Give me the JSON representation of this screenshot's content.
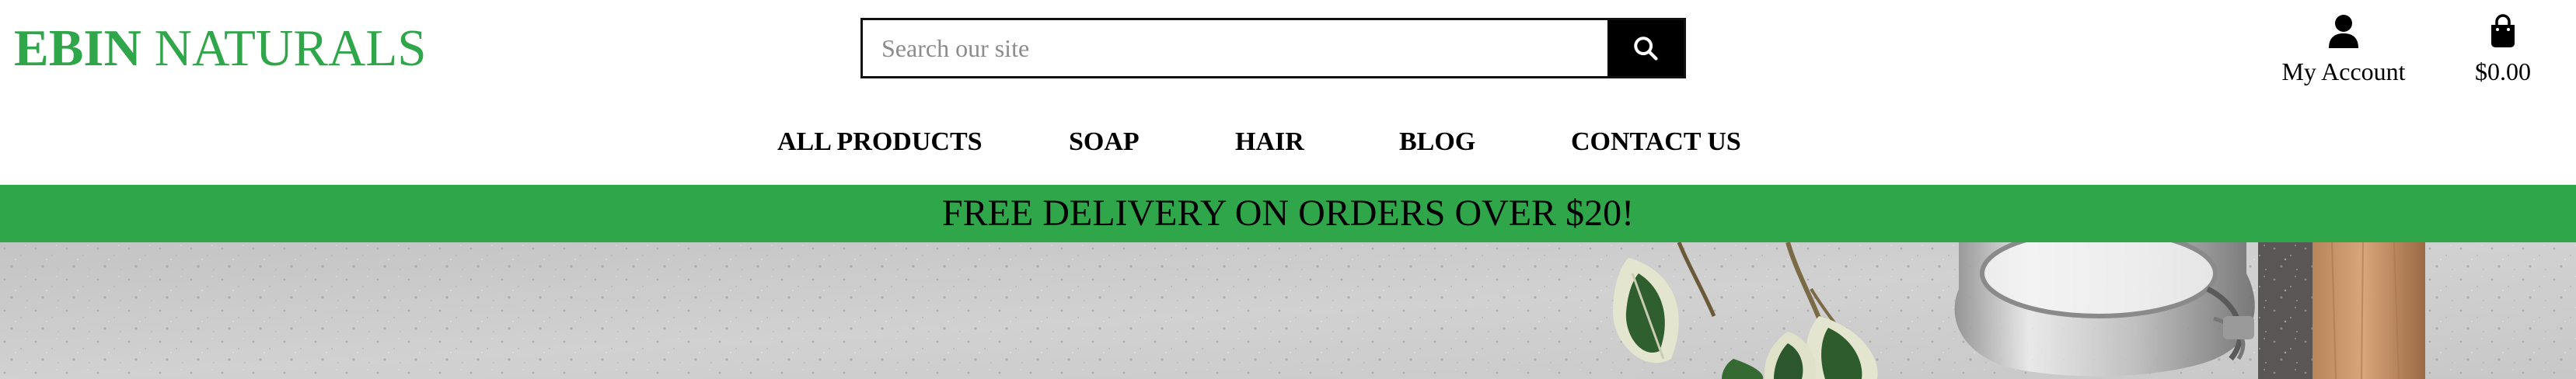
{
  "logo": {
    "bold_part": "EBIN",
    "rest_part": " NATURALS"
  },
  "search": {
    "placeholder": "Search our site",
    "value": ""
  },
  "account": {
    "label": "My Account"
  },
  "cart": {
    "total": "$0.00"
  },
  "nav": {
    "items": [
      {
        "label": "ALL PRODUCTS"
      },
      {
        "label": "SOAP"
      },
      {
        "label": "HAIR"
      },
      {
        "label": "BLOG"
      },
      {
        "label": "CONTACT US"
      }
    ]
  },
  "banner": {
    "text": "FREE DELIVERY ON ORDERS OVER $20!"
  },
  "colors": {
    "brand_green": "#30a64a",
    "search_button": "#000000"
  },
  "icons": [
    "search-icon",
    "user-icon",
    "shopping-bag-icon"
  ]
}
